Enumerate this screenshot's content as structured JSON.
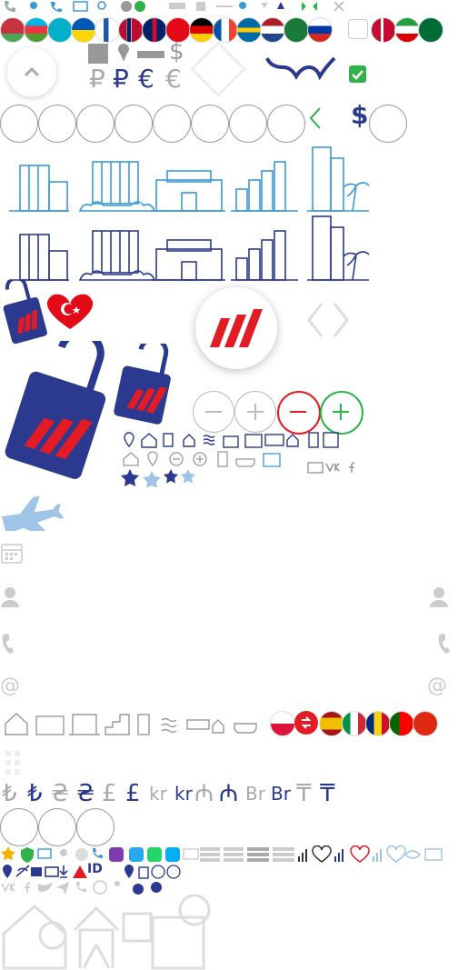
{
  "currency": {
    "top_row": [
      "₽",
      "₽",
      "€",
      "€"
    ],
    "bottom_row": [
      "₺",
      "₺",
      "₴",
      "₴",
      "£",
      "£",
      "kr",
      "kr",
      "₼",
      "₼",
      "Br",
      "Br",
      "₸",
      "₸"
    ],
    "dollar": "$",
    "dollar_header": "$"
  },
  "labels": {
    "id_text": "ID"
  },
  "colors": {
    "brand_red": "#e21b24",
    "navy": "#2b3a8f",
    "sky": "#3a9ad9",
    "green": "#2fb24a",
    "gray": "#c8c8c8"
  }
}
